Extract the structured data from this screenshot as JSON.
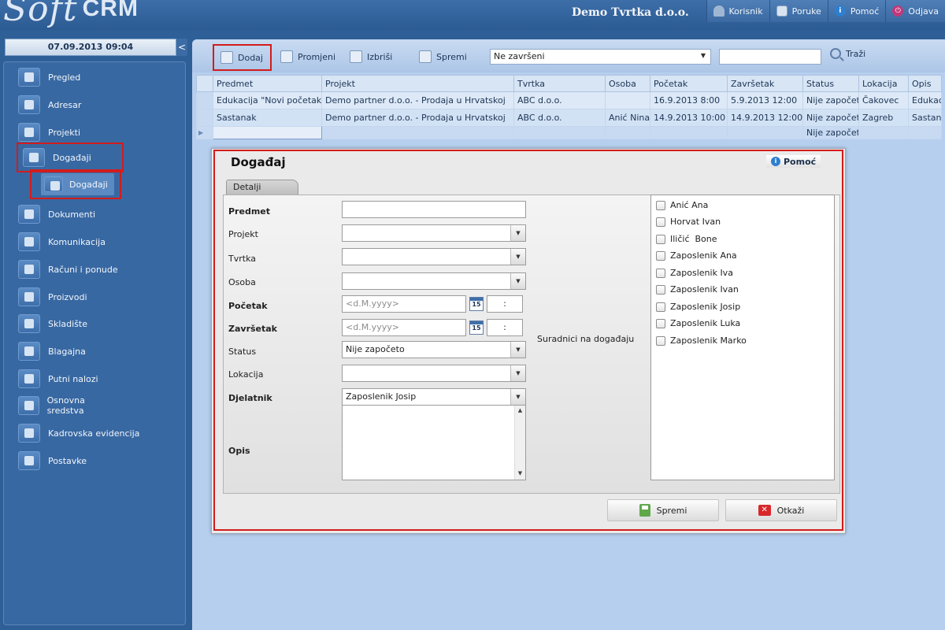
{
  "app": {
    "logo_script": "Soft",
    "logo_bold": "CRM",
    "company": "Demo Tvrtka d.o.o."
  },
  "topnav": [
    {
      "label": "Korisnik",
      "icon": "user-icon"
    },
    {
      "label": "Poruke",
      "icon": "mail-icon"
    },
    {
      "label": "Pomoć",
      "icon": "help-icon"
    },
    {
      "label": "Odjava",
      "icon": "power-icon"
    }
  ],
  "datetime": "07.09.2013 09:04",
  "collapse_glyph": "<",
  "sidebar": {
    "items": [
      {
        "label": "Pregled"
      },
      {
        "label": "Adresar"
      },
      {
        "label": "Projekti"
      },
      {
        "label": "Događaji"
      },
      {
        "label": "Dokumenti"
      },
      {
        "label": "Komunikacija"
      },
      {
        "label": "Računi i ponude"
      },
      {
        "label": "Proizvodi"
      },
      {
        "label": "Skladište"
      },
      {
        "label": "Blagajna"
      },
      {
        "label": "Putni nalozi"
      },
      {
        "label": "Osnovna sredstva"
      },
      {
        "label": "Kadrovska evidencija"
      },
      {
        "label": "Postavke"
      }
    ],
    "submenu_label": "Događaji"
  },
  "toolbar": {
    "add": "Dodaj",
    "edit": "Promjeni",
    "delete": "Izbriši",
    "save": "Spremi",
    "filter_value": "Ne završeni",
    "search": "Traži"
  },
  "grid": {
    "columns": [
      "Predmet",
      "Projekt",
      "Tvrtka",
      "Osoba",
      "Početak",
      "Završetak",
      "Status",
      "Lokacija",
      "Opis"
    ],
    "rows": [
      [
        "Edukacija \"Novi početak\"",
        "Demo partner d.o.o. - Prodaja u Hrvatskoj",
        "ABC d.o.o.",
        "",
        "16.9.2013 8:00",
        "5.9.2013 12:00",
        "Nije započeto",
        "Čakovec",
        "Edukacija"
      ],
      [
        "Sastanak",
        "Demo partner d.o.o. - Prodaja u Hrvatskoj",
        "ABC d.o.o.",
        "Anić Nina",
        "14.9.2013 10:00",
        "14.9.2013 12:00",
        "Nije započeto",
        "Zagreb",
        "Sastanak"
      ],
      [
        "",
        "",
        "",
        "",
        "",
        "",
        "Nije započeto",
        "",
        ""
      ]
    ],
    "new_row_glyph": "▶"
  },
  "dialog": {
    "title": "Događaj",
    "help": "Pomoć",
    "tab": "Detalji",
    "labels": {
      "predmet": "Predmet",
      "projekt": "Projekt",
      "tvrtka": "Tvrtka",
      "osoba": "Osoba",
      "pocetak": "Početak",
      "zavrsetak": "Završetak",
      "status": "Status",
      "lokacija": "Lokacija",
      "djelatnik": "Djelatnik",
      "opis": "Opis",
      "suradnici": "Suradnici na događaju"
    },
    "date_placeholder": "<d.M.yyyy>",
    "calendar_day": "15",
    "time_sep": ":",
    "status_value": "Nije započeto",
    "djelatnik_value": "Zaposlenik Josip",
    "suradnici": [
      "Anić Ana",
      "Horvat Ivan",
      "Iličić  Bone",
      "Zaposlenik Ana",
      "Zaposlenik Iva",
      "Zaposlenik Ivan",
      "Zaposlenik Josip",
      "Zaposlenik Luka",
      "Zaposlenik Marko"
    ],
    "save": "Spremi",
    "cancel": "Otkaži"
  }
}
